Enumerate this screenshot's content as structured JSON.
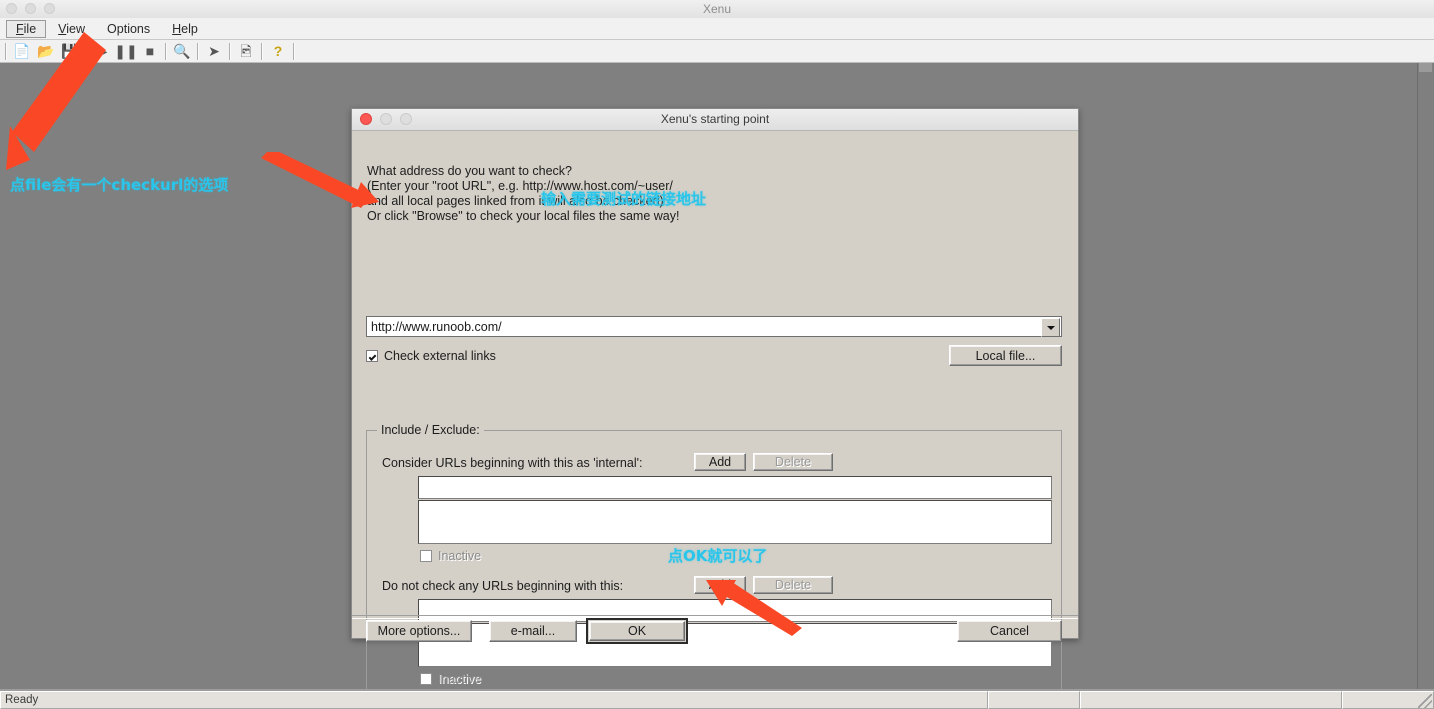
{
  "os": {
    "title": "Xenu",
    "window_buttons": [
      "close",
      "minimize",
      "zoom"
    ]
  },
  "menubar": {
    "items": [
      {
        "label": "File",
        "mnemonic": "F",
        "active": true
      },
      {
        "label": "View",
        "mnemonic": "V",
        "active": false
      },
      {
        "label": "Options",
        "mnemonic": "O",
        "active": false
      },
      {
        "label": "Help",
        "mnemonic": "H",
        "active": false
      }
    ]
  },
  "toolbar": {
    "buttons": [
      {
        "name": "new-file-icon",
        "glyph": "□"
      },
      {
        "name": "open-folder-icon",
        "glyph": "📂"
      },
      {
        "name": "save-icon",
        "glyph": "💾"
      },
      {
        "name": "play-icon",
        "glyph": "▶"
      },
      {
        "name": "pause-icon",
        "glyph": "⏸"
      },
      {
        "name": "stop-icon",
        "glyph": "■"
      },
      {
        "name": "binoculars-icon",
        "glyph": "🔭"
      },
      {
        "name": "arrow-icon",
        "glyph": "➦"
      },
      {
        "name": "report-icon",
        "glyph": "🖼"
      },
      {
        "name": "help-icon",
        "glyph": "?"
      }
    ]
  },
  "dialog": {
    "title": "Xenu's starting point",
    "question": "What address do you want to check?\n(Enter your \"root URL\", e.g. http://www.host.com/~user/\nand all local pages linked from it will also be checked)\nOr click \"Browse\" to check your local files the same way!",
    "url_combo": {
      "value": "http://www.runoob.com/",
      "placeholder": "http://"
    },
    "check_external": {
      "label": "Check external links",
      "checked": true
    },
    "local_file_button": "Local file...",
    "group": {
      "legend": "Include / Exclude:",
      "include": {
        "label": "Consider URLs beginning with this as 'internal':",
        "add_label": "Add",
        "delete_label": "Delete",
        "add_enabled": true,
        "delete_enabled": false,
        "input_value": "",
        "list_items": [],
        "inactive_label": "Inactive",
        "inactive_checked": false
      },
      "exclude": {
        "label": "Do not check any URLs beginning with this:",
        "add_label": "Add",
        "delete_label": "Delete",
        "add_enabled": true,
        "delete_enabled": false,
        "input_value": "",
        "list_items": [],
        "inactive_label": "Inactive",
        "inactive_checked": false
      }
    },
    "footer": {
      "more_options": "More options...",
      "email": "e-mail...",
      "ok": "OK",
      "cancel": "Cancel"
    }
  },
  "statusbar": {
    "message": "Ready",
    "panes": [
      "Ready",
      "",
      "",
      ""
    ]
  },
  "annotations": {
    "color": "#29c5ea",
    "arrow_color": "#fa4826",
    "items": [
      {
        "name": "annotation-file-menu",
        "text": "点file会有一个checkurl的选项"
      },
      {
        "name": "annotation-url-input",
        "text": "输入需要测试的链接地址"
      },
      {
        "name": "annotation-ok-button",
        "text": "点OK就可以了"
      }
    ]
  }
}
